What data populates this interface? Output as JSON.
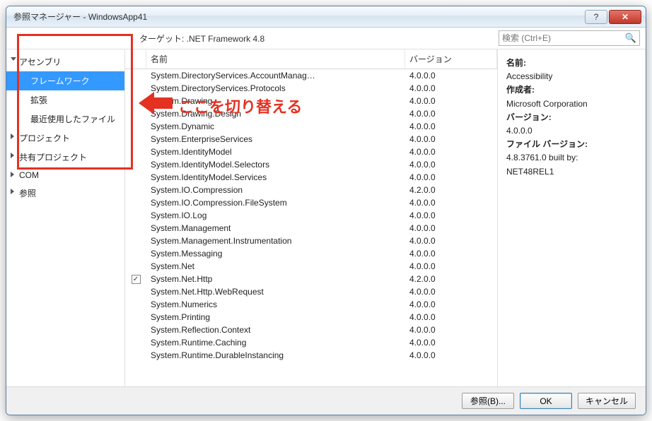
{
  "window": {
    "title": "参照マネージャー - WindowsApp41"
  },
  "topbar": {
    "target": "ターゲット: .NET Framework 4.8",
    "search_placeholder": "検索 (Ctrl+E)"
  },
  "sidebar": {
    "items": [
      {
        "label": "アセンブリ",
        "expanded": true
      },
      {
        "label": "プロジェクト",
        "expanded": false
      },
      {
        "label": "共有プロジェクト",
        "expanded": false
      },
      {
        "label": "COM",
        "expanded": false
      },
      {
        "label": "参照",
        "expanded": false
      }
    ],
    "subitems": [
      {
        "label": "フレームワーク",
        "selected": true
      },
      {
        "label": "拡張",
        "selected": false
      },
      {
        "label": "最近使用したファイル",
        "selected": false
      }
    ]
  },
  "annotation": {
    "label": "ここを切り替える"
  },
  "columns": {
    "name": "名前",
    "version": "バージョン"
  },
  "assemblies": [
    {
      "name": "System.DirectoryServices.AccountManag…",
      "version": "4.0.0.0",
      "checked": false
    },
    {
      "name": "System.DirectoryServices.Protocols",
      "version": "4.0.0.0",
      "checked": false
    },
    {
      "name": "System.Drawing",
      "version": "4.0.0.0",
      "checked": false
    },
    {
      "name": "System.Drawing.Design",
      "version": "4.0.0.0",
      "checked": false
    },
    {
      "name": "System.Dynamic",
      "version": "4.0.0.0",
      "checked": false
    },
    {
      "name": "System.EnterpriseServices",
      "version": "4.0.0.0",
      "checked": false
    },
    {
      "name": "System.IdentityModel",
      "version": "4.0.0.0",
      "checked": false
    },
    {
      "name": "System.IdentityModel.Selectors",
      "version": "4.0.0.0",
      "checked": false
    },
    {
      "name": "System.IdentityModel.Services",
      "version": "4.0.0.0",
      "checked": false
    },
    {
      "name": "System.IO.Compression",
      "version": "4.2.0.0",
      "checked": false
    },
    {
      "name": "System.IO.Compression.FileSystem",
      "version": "4.0.0.0",
      "checked": false
    },
    {
      "name": "System.IO.Log",
      "version": "4.0.0.0",
      "checked": false
    },
    {
      "name": "System.Management",
      "version": "4.0.0.0",
      "checked": false
    },
    {
      "name": "System.Management.Instrumentation",
      "version": "4.0.0.0",
      "checked": false
    },
    {
      "name": "System.Messaging",
      "version": "4.0.0.0",
      "checked": false
    },
    {
      "name": "System.Net",
      "version": "4.0.0.0",
      "checked": false
    },
    {
      "name": "System.Net.Http",
      "version": "4.2.0.0",
      "checked": true
    },
    {
      "name": "System.Net.Http.WebRequest",
      "version": "4.0.0.0",
      "checked": false
    },
    {
      "name": "System.Numerics",
      "version": "4.0.0.0",
      "checked": false
    },
    {
      "name": "System.Printing",
      "version": "4.0.0.0",
      "checked": false
    },
    {
      "name": "System.Reflection.Context",
      "version": "4.0.0.0",
      "checked": false
    },
    {
      "name": "System.Runtime.Caching",
      "version": "4.0.0.0",
      "checked": false
    },
    {
      "name": "System.Runtime.DurableInstancing",
      "version": "4.0.0.0",
      "checked": false
    }
  ],
  "details": {
    "name_label": "名前:",
    "name_value": "Accessibility",
    "author_label": "作成者:",
    "author_value": "Microsoft Corporation",
    "version_label": "バージョン:",
    "version_value": "4.0.0.0",
    "filever_label": "ファイル バージョン:",
    "filever_value1": "4.8.3761.0 built by:",
    "filever_value2": "NET48REL1"
  },
  "footer": {
    "browse": "参照(B)...",
    "ok": "OK",
    "cancel": "キャンセル"
  }
}
